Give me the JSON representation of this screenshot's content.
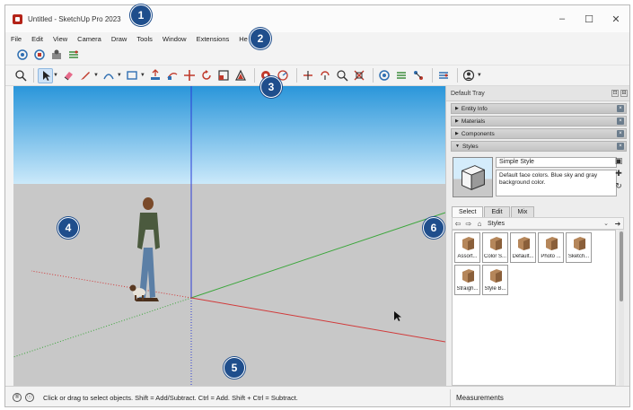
{
  "window": {
    "title": "Untitled - SketchUp Pro 2023",
    "minimize": "–",
    "maximize": "☐",
    "close": "✕"
  },
  "menu": [
    "File",
    "Edit",
    "View",
    "Camera",
    "Draw",
    "Tools",
    "Window",
    "Extensions",
    "He"
  ],
  "toolbar_getting_started": [
    "warehouse-icon",
    "extension-warehouse-icon",
    "extension-manager-icon",
    "layout-icon"
  ],
  "toolbar_large": [
    "zoom-icon",
    "select-icon",
    "eraser-icon",
    "pencil-icon",
    "arc-icon",
    "rectangle-icon",
    "push-pull-icon",
    "follow-me-icon",
    "move-icon",
    "rotate-icon",
    "scale-icon",
    "offset-icon",
    "tape-measure-icon",
    "protractor-icon",
    "section-plane-icon",
    "orbit-icon",
    "pan-icon",
    "zoom-extents-icon",
    "warehouse-icon",
    "extension-icon",
    "layout-icon",
    "account-icon"
  ],
  "tray": {
    "title": "Default Tray",
    "panels": [
      "Entity Info",
      "Materials",
      "Components",
      "Styles"
    ],
    "style_name": "Simple Style",
    "style_description": "Default face colors. Blue sky and gray background color.",
    "tabs": [
      "Select",
      "Edit",
      "Mix"
    ],
    "collection": "Styles",
    "styles": [
      "Assort...",
      "Color S...",
      "Default...",
      "Photo ...",
      "Sketch...",
      "Straigh...",
      "Style B..."
    ]
  },
  "status": {
    "hint": "Click or drag to select objects. Shift = Add/Subtract. Ctrl = Add. Shift + Ctrl = Subtract.",
    "measurements_label": "Measurements"
  },
  "callouts": [
    "1",
    "2",
    "3",
    "4",
    "5",
    "6"
  ],
  "colors": {
    "sky_top": "#2a96da",
    "sky_bottom": "#cbe9fa",
    "ground": "#c8c8c8",
    "callout": "#1f4e8c",
    "accent": "#b42318"
  }
}
